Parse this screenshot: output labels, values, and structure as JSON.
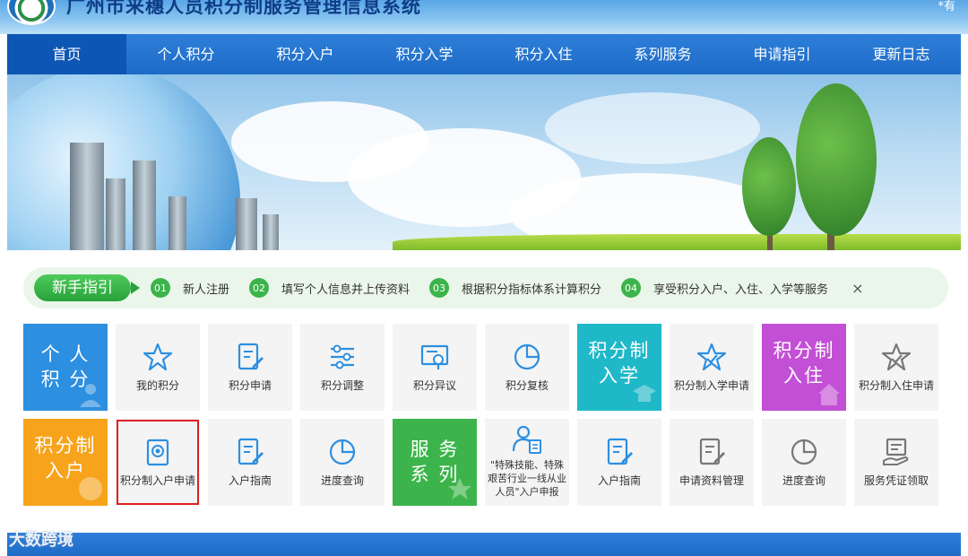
{
  "header": {
    "title": "广州市来穗人员积分制服务管理信息系统",
    "user_text": "*有"
  },
  "nav": {
    "items": [
      "首页",
      "个人积分",
      "积分入户",
      "积分入学",
      "积分入住",
      "系列服务",
      "申请指引",
      "更新日志"
    ],
    "active_index": 0
  },
  "guide": {
    "title": "新手指引",
    "steps": [
      {
        "num": "01",
        "text": "新人注册"
      },
      {
        "num": "02",
        "text": "填写个人信息并上传资料"
      },
      {
        "num": "03",
        "text": "根据积分指标体系计算积分"
      },
      {
        "num": "04",
        "text": "享受积分入户、入住、入学等服务"
      }
    ],
    "close": "×"
  },
  "tiles_row1": {
    "personal_points": "个 人 积 分",
    "my_points": "我的积分",
    "points_apply": "积分申请",
    "points_adjust": "积分调整",
    "points_objection": "积分异议",
    "points_review": "积分复核",
    "school_big": "积分制入学",
    "school_apply": "积分制入学申请",
    "housing_big": "积分制入住",
    "housing_apply": "积分制入住申请"
  },
  "tiles_row2": {
    "hukou_big": "积分制入户",
    "hukou_apply": "积分制入户申请",
    "hukou_guide": "入户指南",
    "progress_query": "进度查询",
    "service_big": "服 务 系 列",
    "special_hukou": "\"特殊技能、特殊艰苦行业一线从业人员\"入户申报",
    "hukou_guide2": "入户指南",
    "material_manage": "申请资料管理",
    "progress_query2": "进度查询",
    "voucher_collect": "服务凭证领取"
  },
  "colors": {
    "nav_blue": "#1d6bc7",
    "tile_blue": "#2d8fe0",
    "tile_cyan": "#1fb8c9",
    "tile_purple": "#c34fd6",
    "tile_orange": "#f7a31c",
    "tile_green": "#3cb44b",
    "highlight_red": "#e02020"
  },
  "watermark": "大数跨境"
}
